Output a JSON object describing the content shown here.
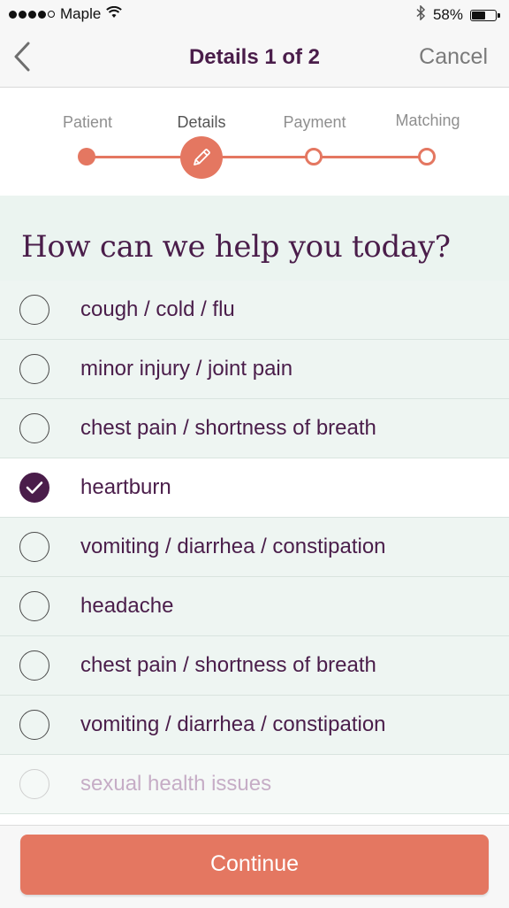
{
  "status_bar": {
    "carrier": "Maple",
    "battery_percent": "58%",
    "battery_level": 0.58,
    "icons": [
      "signal-dots-icon",
      "wifi-icon",
      "bluetooth-icon",
      "battery-icon"
    ]
  },
  "nav": {
    "back_icon": "chevron-left-icon",
    "title": "Details 1 of 2",
    "cancel_label": "Cancel"
  },
  "progress": {
    "steps": [
      {
        "label": "Patient",
        "state": "done"
      },
      {
        "label": "Details",
        "state": "current",
        "icon": "pencil-icon"
      },
      {
        "label": "Payment",
        "state": "todo"
      },
      {
        "label": "Matching",
        "state": "todo"
      }
    ]
  },
  "question": "How can we help you today?",
  "options": [
    {
      "label": "cough / cold / flu",
      "selected": false
    },
    {
      "label": "minor injury / joint pain",
      "selected": false
    },
    {
      "label": "chest pain / shortness of breath",
      "selected": false
    },
    {
      "label": "heartburn",
      "selected": true
    },
    {
      "label": "vomiting / diarrhea / constipation",
      "selected": false
    },
    {
      "label": "headache",
      "selected": false
    },
    {
      "label": "chest pain / shortness of breath",
      "selected": false
    },
    {
      "label": "vomiting / diarrhea / constipation",
      "selected": false
    },
    {
      "label": "sexual health issues",
      "selected": false
    }
  ],
  "footer": {
    "continue_label": "Continue"
  },
  "colors": {
    "accent": "#e47761",
    "brand_purple": "#4a1d4a",
    "option_bg": "#eef5f2"
  }
}
